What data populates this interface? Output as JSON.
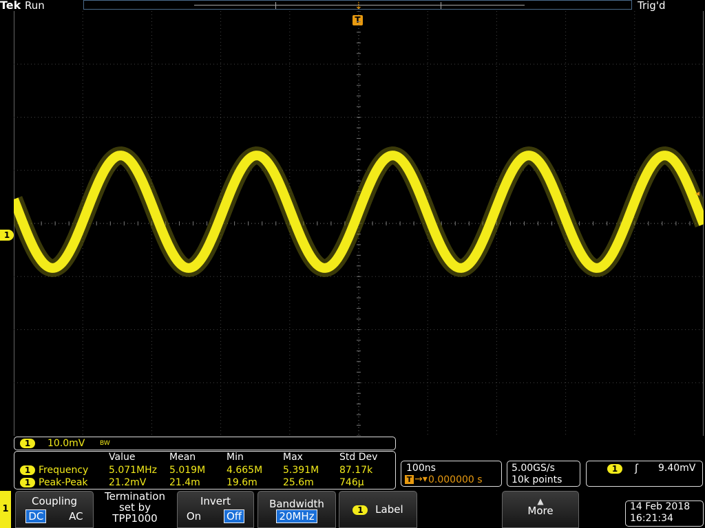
{
  "header": {
    "brand": "Tek",
    "state": "Run",
    "trigger_status": "Trig'd"
  },
  "trigger_marker": "T",
  "channel": {
    "id": "1",
    "scale": "10.0mV",
    "bw_symbol": "BW"
  },
  "measurements": {
    "columns": [
      "Value",
      "Mean",
      "Min",
      "Max",
      "Std Dev"
    ],
    "rows": [
      {
        "ch": "1",
        "name": "Frequency",
        "values": [
          "5.071MHz",
          "5.019M",
          "4.665M",
          "5.391M",
          "87.17k"
        ]
      },
      {
        "ch": "1",
        "name": "Peak-Peak",
        "values": [
          "21.2mV",
          "21.4m",
          "19.6m",
          "25.6m",
          "746µ"
        ]
      }
    ]
  },
  "horizontal": {
    "scale": "100ns",
    "delay": "0.000000 s"
  },
  "acquisition": {
    "rate": "5.00GS/s",
    "points": "10k points"
  },
  "trigger": {
    "ch": "1",
    "slope_icon": "rising-edge-icon",
    "level": "9.40mV"
  },
  "menu": {
    "coupling": {
      "label": "Coupling",
      "options": [
        "DC",
        "AC"
      ],
      "selected": "DC"
    },
    "termination": {
      "line1": "Termination",
      "line2": "set by",
      "line3": "TPP1000"
    },
    "invert": {
      "label": "Invert",
      "options": [
        "On",
        "Off"
      ],
      "selected": "Off"
    },
    "bandwidth": {
      "label": "Bandwidth",
      "value": "20MHz"
    },
    "label_btn": {
      "ch": "1",
      "label": "Label"
    },
    "more": "More"
  },
  "datetime": {
    "date": "14 Feb 2018",
    "time": "16:21:34"
  },
  "waveform": {
    "color": "#f3eb1a",
    "frequency_mhz": 5.071,
    "peak_to_peak_mv": 21.2,
    "volts_per_div_mv": 10.0,
    "time_per_div_ns": 100
  }
}
